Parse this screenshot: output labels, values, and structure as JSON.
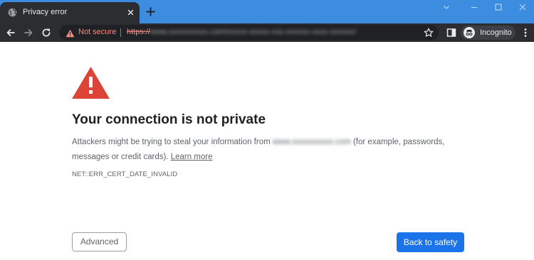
{
  "tab": {
    "title": "Privacy error",
    "favicon": "globe-icon",
    "close": "close-icon"
  },
  "new_tab": "plus-icon",
  "window_controls": [
    "chevron-down-icon",
    "minimize-icon",
    "maximize-icon",
    "close-icon"
  ],
  "toolbar": {
    "back": "back-arrow-icon",
    "forward": "forward-arrow-icon",
    "reload": "reload-icon",
    "security_icon": "warning-triangle-icon",
    "security_label": "Not secure",
    "url_scheme": "https://",
    "url_rest": "www.xxxxxxxxxx.com/xxxxx-xxxxx-xxx-xxxxxx-xxxx-xxxxxx/",
    "bookmark": "star-icon",
    "side_panel": "side-panel-icon",
    "profile_label": "Incognito",
    "profile_icon": "incognito-icon",
    "menu": "more-vert-icon"
  },
  "page": {
    "warning_icon": "warning-triangle-icon",
    "heading": "Your connection is not private",
    "body_before": "Attackers might be trying to steal your information from ",
    "body_domain": "www.xxxxxxxxxx.com",
    "body_after": " (for example, passwords, messages or credit cards). ",
    "learn_more": "Learn more",
    "error_code": "NET::ERR_CERT_DATE_INVALID",
    "advanced_label": "Advanced",
    "safety_label": "Back to safety"
  },
  "colors": {
    "tab_strip": "#3c8ddf",
    "toolbar": "#2b2d31",
    "omnibox": "#202124",
    "not_secure": "#f28b82",
    "warning_red": "#db4437",
    "primary_button": "#1a73e8",
    "heading_text": "#202124",
    "body_text": "#5f6368"
  }
}
